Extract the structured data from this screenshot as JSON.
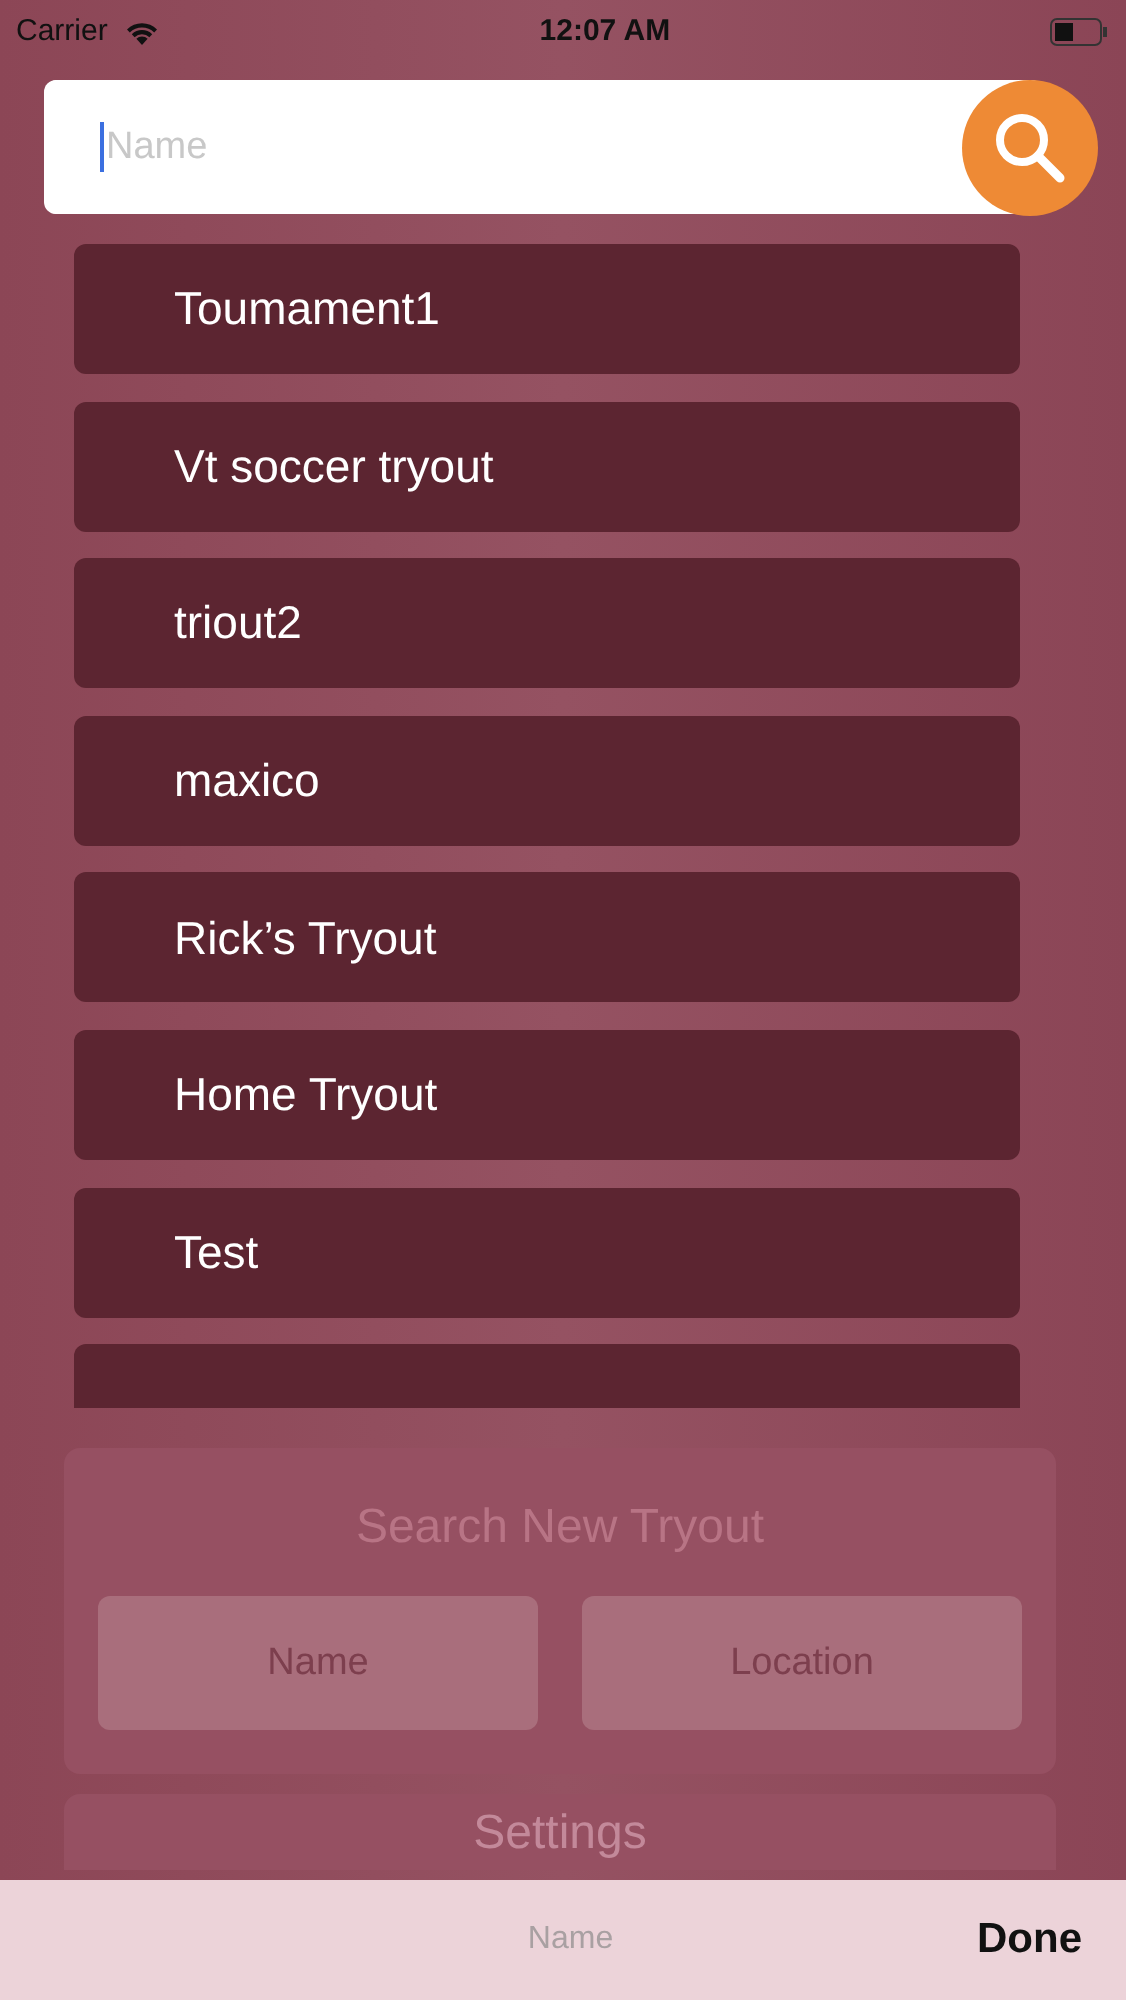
{
  "status_bar": {
    "carrier": "Carrier",
    "time": "12:07 AM"
  },
  "search": {
    "placeholder": "Name",
    "focused": true
  },
  "results": [
    {
      "label": "Toumament1"
    },
    {
      "label": "Vt soccer tryout"
    },
    {
      "label": "triout2"
    },
    {
      "label": "maxico"
    },
    {
      "label": "Rick’s Tryout"
    },
    {
      "label": "Home Tryout"
    },
    {
      "label": "Test"
    }
  ],
  "search_new_tryout": {
    "title": "Search New Tryout",
    "fields": [
      {
        "placeholder": "Name"
      },
      {
        "placeholder": "Location"
      }
    ]
  },
  "settings": {
    "title": "Settings"
  },
  "keyboard_toolbar": {
    "title": "Name",
    "done": "Done"
  }
}
